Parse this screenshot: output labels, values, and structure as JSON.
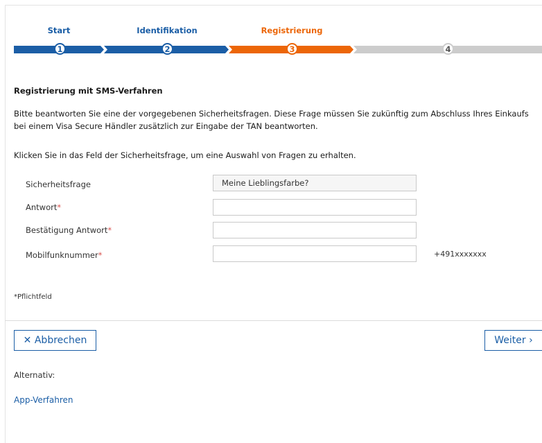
{
  "stepper": {
    "steps": [
      {
        "label": "Start",
        "number": "1",
        "status": "done"
      },
      {
        "label": "Identifikation",
        "number": "2",
        "status": "done"
      },
      {
        "label": "Registrierung",
        "number": "3",
        "status": "active"
      },
      {
        "label": "",
        "number": "4",
        "status": "pending"
      }
    ],
    "colors": {
      "done": "#1b5ea6",
      "active": "#ec6608",
      "pending": "#cccccc"
    }
  },
  "content": {
    "title": "Registrierung mit SMS-Verfahren",
    "intro": "Bitte beantworten Sie eine der vorgegebenen Sicherheitsfragen. Diese Frage müssen Sie zukünftig zum Abschluss Ihres Einkaufs bei einem Visa Secure Händler zusätzlich zur Eingabe der TAN beantworten.",
    "hint": "Klicken Sie in das Feld der Sicherheitsfrage, um eine Auswahl von Fragen zu erhalten."
  },
  "form": {
    "security_question": {
      "label": "Sicherheitsfrage",
      "value": "Meine Lieblingsfarbe?"
    },
    "answer": {
      "label": "Antwort",
      "value": ""
    },
    "confirm_answer": {
      "label": "Bestätigung Antwort",
      "value": ""
    },
    "mobile": {
      "label": "Mobilfunknummer",
      "value": "",
      "hint": "+491xxxxxxx"
    },
    "required_marker": "*",
    "required_note": "*Pflichtfeld"
  },
  "actions": {
    "cancel": "✕ Abbrechen",
    "next": "Weiter ›"
  },
  "alternative": {
    "label": "Alternativ:",
    "link": "App-Verfahren"
  }
}
